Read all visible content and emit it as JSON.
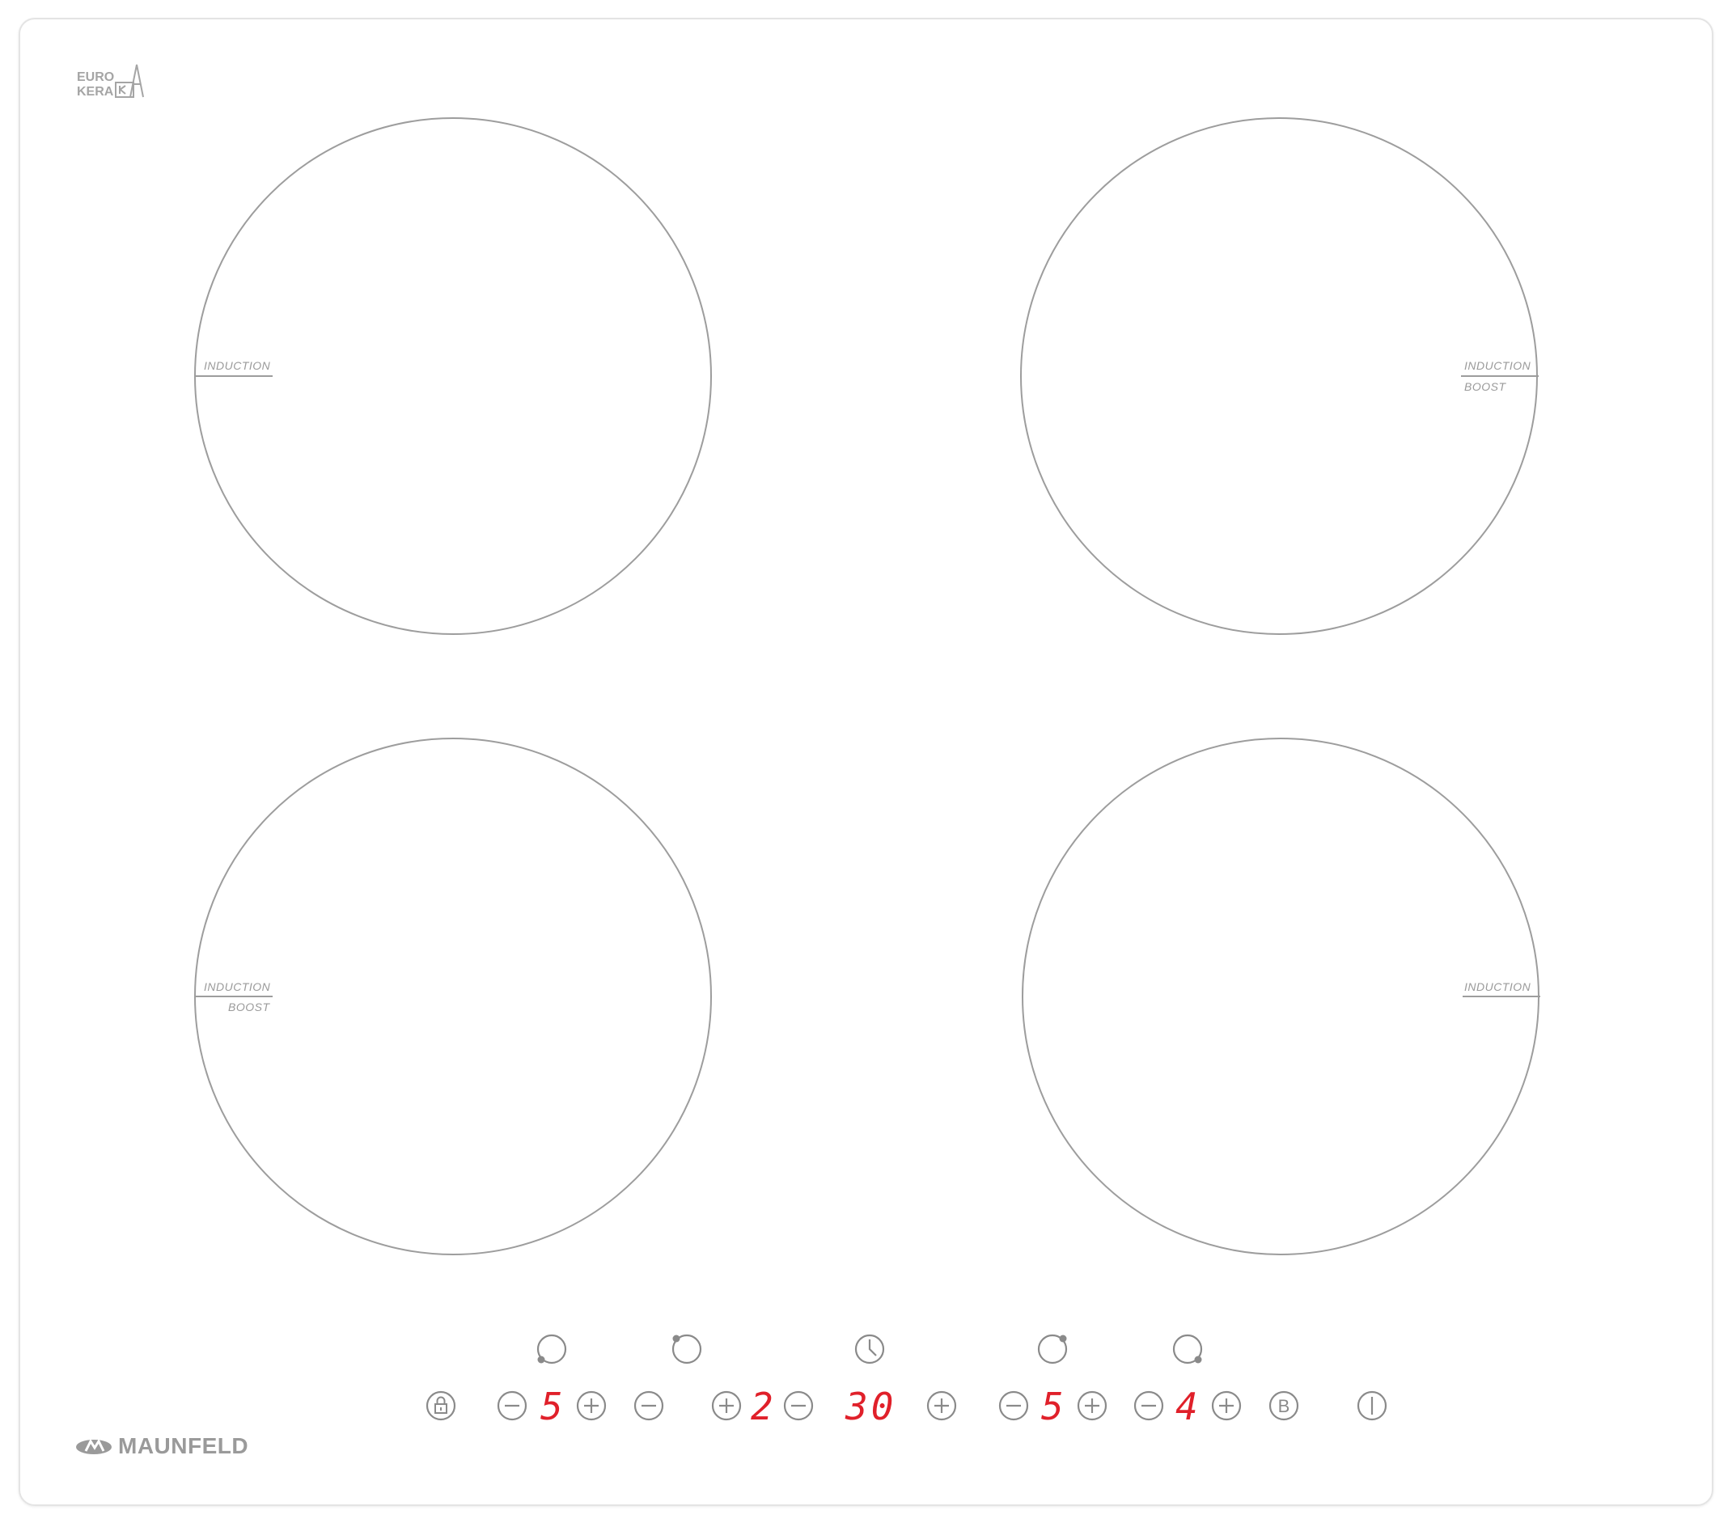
{
  "brand": {
    "certification_logo": "EUROKERA",
    "certification_line1": "EURO",
    "certification_line2": "KERA",
    "manufacturer": "MAUNFELD"
  },
  "zones": [
    {
      "id": "front-left-top",
      "label_top": "INDUCTION",
      "label_bottom": ""
    },
    {
      "id": "top-right",
      "label_top": "INDUCTION",
      "label_bottom": "BOOST"
    },
    {
      "id": "bottom-left",
      "label_top": "INDUCTION",
      "label_bottom": "BOOST"
    },
    {
      "id": "bottom-right",
      "label_top": "INDUCTION",
      "label_bottom": ""
    }
  ],
  "controls": {
    "zone_selectors": [
      "zone-bottom-left-icon",
      "zone-top-left-icon",
      "timer-clock-icon",
      "zone-top-right-icon",
      "zone-bottom-right-icon"
    ],
    "displays": {
      "zone1_level": "5",
      "zone2_level": "2",
      "timer": "30",
      "zone3_level": "5",
      "zone4_level": "4"
    },
    "boost_label": "B",
    "colors": {
      "display": "#e0202a",
      "icons": "#8a8a8a",
      "zone_outline": "#9d9d9d"
    }
  }
}
